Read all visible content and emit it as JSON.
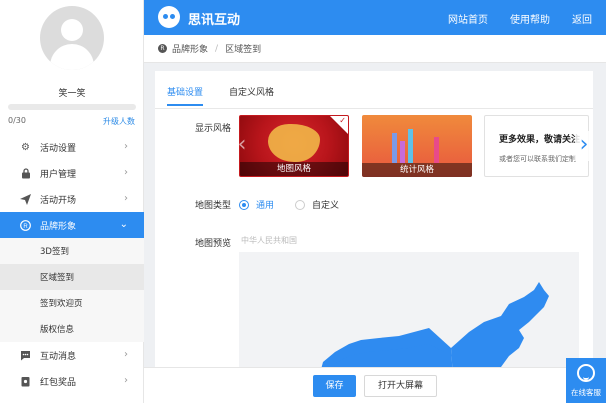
{
  "user": {
    "name": "笑一笑",
    "quota": "0/30",
    "upgrade": "升级人数",
    "avatar_icon": "user-avatar-icon"
  },
  "sidebar": {
    "items": [
      {
        "label": "活动设置",
        "icon": "gear-icon"
      },
      {
        "label": "用户管理",
        "icon": "lock-icon"
      },
      {
        "label": "活动开场",
        "icon": "send-icon"
      },
      {
        "label": "品牌形象",
        "icon": "brand-icon",
        "active": true
      },
      {
        "label": "互动消息",
        "icon": "message-icon"
      },
      {
        "label": "红包奖品",
        "icon": "gift-icon"
      }
    ],
    "subitems": [
      "3D签到",
      "区域签到",
      "签到欢迎页",
      "版权信息"
    ]
  },
  "header": {
    "brand": "思讯互动",
    "nav": [
      "网站首页",
      "使用帮助",
      "返回"
    ],
    "accent": "#2d8cf0"
  },
  "breadcrumb": {
    "root": "品牌形象",
    "current": "区域签到"
  },
  "tabs": [
    "基础设置",
    "自定义风格"
  ],
  "form": {
    "style_label": "显示风格",
    "styles": [
      {
        "name": "地图风格",
        "selected": true
      },
      {
        "name": "统计风格",
        "selected": false
      }
    ],
    "promo": {
      "title": "更多效果，敬请关注",
      "subtitle": "或者您可以联系我们定制"
    },
    "map_type_label": "地图类型",
    "map_types": [
      {
        "label": "通用",
        "checked": true
      },
      {
        "label": "自定义",
        "checked": false
      }
    ],
    "preview_label": "地图预览",
    "map_caption": "中华人民共和国",
    "map_color": "#2f8bf0"
  },
  "footer": {
    "save": "保存",
    "open_screen": "打开大屏幕"
  },
  "support": {
    "label": "在线客服"
  }
}
